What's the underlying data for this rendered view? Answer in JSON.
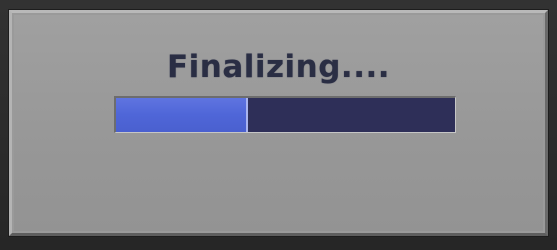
{
  "dialog": {
    "title": "Finalizing....",
    "progress": {
      "fraction": 0.39,
      "fill_color": "#5068d8",
      "track_color": "#2e2f58"
    }
  }
}
